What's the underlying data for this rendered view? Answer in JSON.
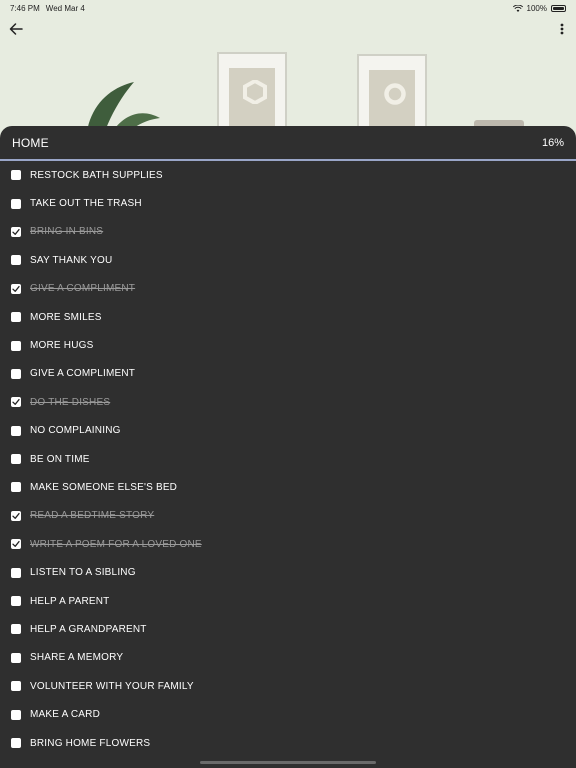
{
  "status": {
    "time": "7:46 PM",
    "date": "Wed Mar 4",
    "battery": "100%"
  },
  "list": {
    "title": "HOME",
    "progress": "16%",
    "items": [
      {
        "label": "RESTOCK BATH SUPPLIES",
        "done": false
      },
      {
        "label": "TAKE OUT THE TRASH",
        "done": false
      },
      {
        "label": "BRING IN BINS",
        "done": true
      },
      {
        "label": "SAY THANK YOU",
        "done": false
      },
      {
        "label": "GIVE A COMPLIMENT",
        "done": true
      },
      {
        "label": "MORE SMILES",
        "done": false
      },
      {
        "label": "MORE HUGS",
        "done": false
      },
      {
        "label": "GIVE A COMPLIMENT",
        "done": false
      },
      {
        "label": "DO THE DISHES",
        "done": true
      },
      {
        "label": "NO COMPLAINING",
        "done": false
      },
      {
        "label": "BE ON TIME",
        "done": false
      },
      {
        "label": "MAKE SOMEONE ELSE'S BED",
        "done": false
      },
      {
        "label": "READ A BEDTIME STORY",
        "done": true
      },
      {
        "label": "WRITE A POEM FOR A LOVED ONE",
        "done": true
      },
      {
        "label": "LISTEN TO A SIBLING",
        "done": false
      },
      {
        "label": "HELP A PARENT",
        "done": false
      },
      {
        "label": "HELP A GRANDPARENT",
        "done": false
      },
      {
        "label": "SHARE A MEMORY",
        "done": false
      },
      {
        "label": "VOLUNTEER WITH YOUR FAMILY",
        "done": false
      },
      {
        "label": "MAKE A CARD",
        "done": false
      },
      {
        "label": "BRING HOME FLOWERS",
        "done": false
      }
    ]
  },
  "icons": {
    "back": "arrow-left-icon",
    "menu": "more-vertical-icon",
    "wifi": "wifi-icon",
    "battery": "battery-icon",
    "check": "check-icon"
  },
  "colors": {
    "background": "#e7ece0",
    "sheet": "#2f2f2f",
    "divider": "#9aa6c8",
    "done_text": "#9a9a9a"
  }
}
